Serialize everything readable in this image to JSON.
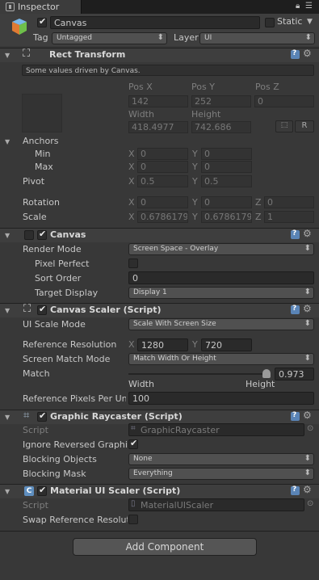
{
  "tab": {
    "label": "Inspector"
  },
  "object": {
    "name": "Canvas",
    "static_label": "Static",
    "tag_label": "Tag",
    "tag_value": "Untagged",
    "layer_label": "Layer",
    "layer_value": "UI"
  },
  "rect_transform": {
    "title": "Rect Transform",
    "note": "Some values driven by Canvas.",
    "pos_x_label": "Pos X",
    "pos_y_label": "Pos Y",
    "pos_z_label": "Pos Z",
    "pos_x": "142",
    "pos_y": "252",
    "pos_z": "0",
    "width_label": "Width",
    "height_label": "Height",
    "width": "418.4977",
    "height": "742.686",
    "r_button": "R",
    "anchors_label": "Anchors",
    "min_label": "Min",
    "max_label": "Max",
    "anchor_min_x": "0",
    "anchor_min_y": "0",
    "anchor_max_x": "0",
    "anchor_max_y": "0",
    "pivot_label": "Pivot",
    "pivot_x": "0.5",
    "pivot_y": "0.5",
    "rotation_label": "Rotation",
    "rot_x": "0",
    "rot_y": "0",
    "rot_z": "0",
    "scale_label": "Scale",
    "scale_x": "0.6786179",
    "scale_y": "0.6786179",
    "scale_z": "1",
    "x": "X",
    "y": "Y",
    "z": "Z"
  },
  "canvas": {
    "title": "Canvas",
    "render_mode_label": "Render Mode",
    "render_mode": "Screen Space - Overlay",
    "pixel_perfect_label": "Pixel Perfect",
    "sort_order_label": "Sort Order",
    "sort_order": "0",
    "target_display_label": "Target Display",
    "target_display": "Display 1"
  },
  "canvas_scaler": {
    "title": "Canvas Scaler (Script)",
    "ui_scale_mode_label": "UI Scale Mode",
    "ui_scale_mode": "Scale With Screen Size",
    "ref_res_label": "Reference Resolution",
    "ref_x": "1280",
    "ref_y": "720",
    "screen_match_label": "Screen Match Mode",
    "screen_match": "Match Width Or Height",
    "match_label": "Match",
    "match_value": "0.973",
    "match_fraction": 0.973,
    "width_label": "Width",
    "height_label": "Height",
    "ref_ppu_label": "Reference Pixels Per Uni",
    "ref_ppu": "100"
  },
  "graphic_raycaster": {
    "title": "Graphic Raycaster (Script)",
    "script_label": "Script",
    "script_value": "GraphicRaycaster",
    "ignore_label": "Ignore Reversed Graphic",
    "blocking_objects_label": "Blocking Objects",
    "blocking_objects": "None",
    "blocking_mask_label": "Blocking Mask",
    "blocking_mask": "Everything"
  },
  "material_ui_scaler": {
    "title": "Material UI Scaler (Script)",
    "script_label": "Script",
    "script_value": "MaterialUIScaler",
    "swap_label": "Swap Reference Resoluti"
  },
  "add_component": "Add Component"
}
